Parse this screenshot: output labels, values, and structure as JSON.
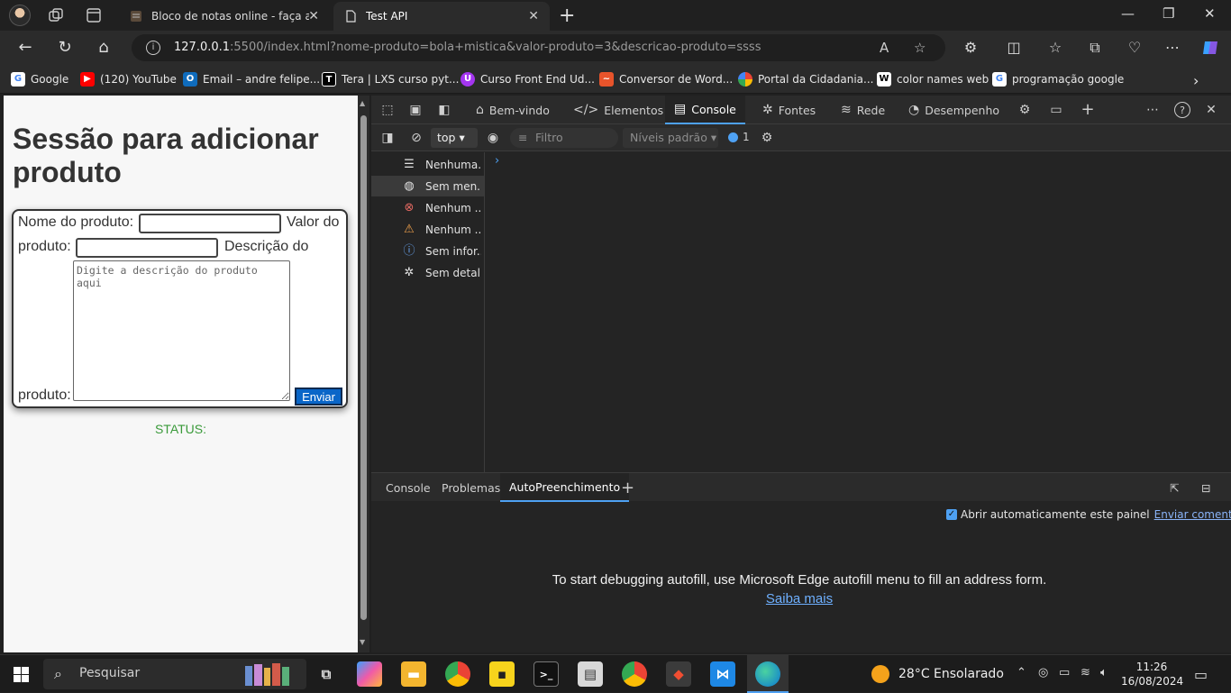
{
  "browser": {
    "tabs": [
      {
        "title": "Bloco de notas online - faça anot",
        "active": false
      },
      {
        "title": "Test API",
        "active": true
      }
    ],
    "url_host": "127.0.0.1",
    "url_rest": ":5500/index.html?nome-produto=bola+mistica&valor-produto=3&descricao-produto=ssss",
    "bookmarks": [
      {
        "label": "Google",
        "icon": "google-icon",
        "color": "#ea4335"
      },
      {
        "label": "(120) YouTube",
        "icon": "youtube-icon",
        "color": "#ff0000"
      },
      {
        "label": "Email – andre felipe...",
        "icon": "outlook-icon",
        "color": "#0f6cbd"
      },
      {
        "label": "Tera | LXS curso pyt...",
        "icon": "tera-icon",
        "color": "#000000"
      },
      {
        "label": "Curso Front End Ud...",
        "icon": "udemy-icon",
        "color": "#a435f0"
      },
      {
        "label": "Conversor de Word...",
        "icon": "converter-icon",
        "color": "#e8542b"
      },
      {
        "label": "Portal da Cidadania...",
        "icon": "portal-icon",
        "color": "#34a853"
      },
      {
        "label": "color names web",
        "icon": "wikipedia-icon",
        "color": "#ffffff"
      },
      {
        "label": "programação google",
        "icon": "google-icon",
        "color": "#ea4335"
      }
    ]
  },
  "page": {
    "heading": "Sessão para adicionar produto",
    "form": {
      "name_label": "Nome do produto:",
      "value_label_1": "Valor do",
      "value_label_2": "produto:",
      "desc_label_1": "Descrição do",
      "desc_label_2": "produto:",
      "desc_placeholder": "Digite a descrição do produto aqui",
      "submit_label": "Enviar"
    },
    "status_label": "STATUS:"
  },
  "devtools": {
    "tabs": [
      "Bem-vindo",
      "Elementos",
      "Console",
      "Fontes",
      "Rede",
      "Desempenho"
    ],
    "active_tab": "Console",
    "context": "top",
    "filter_placeholder": "Filtro",
    "levels": "Níveis padrão",
    "message_count": "1",
    "sidebar": [
      {
        "label": "Nenhuma...",
        "icon": "list-icon"
      },
      {
        "label": "Sem men...",
        "icon": "user-icon"
      },
      {
        "label": "Nenhum ...",
        "icon": "error-icon"
      },
      {
        "label": "Nenhum ...",
        "icon": "warning-icon"
      },
      {
        "label": "Sem infor...",
        "icon": "info-icon"
      },
      {
        "label": "Sem detal...",
        "icon": "bug-icon"
      }
    ],
    "drawer_tabs": [
      "Console",
      "Problemas",
      "AutoPreenchimento"
    ],
    "drawer_active": "AutoPreenchimento",
    "auto_open_label": "Abrir automaticamente este painel",
    "feedback_link": "Enviar comentários",
    "autofill_message": "To start debugging autofill, use Microsoft Edge autofill menu to fill an address form.",
    "learn_more": "Saiba mais"
  },
  "taskbar": {
    "search_placeholder": "Pesquisar",
    "weather_temp": "28°C",
    "weather_text": "Ensolarado",
    "time": "11:26",
    "date": "16/08/2024"
  }
}
